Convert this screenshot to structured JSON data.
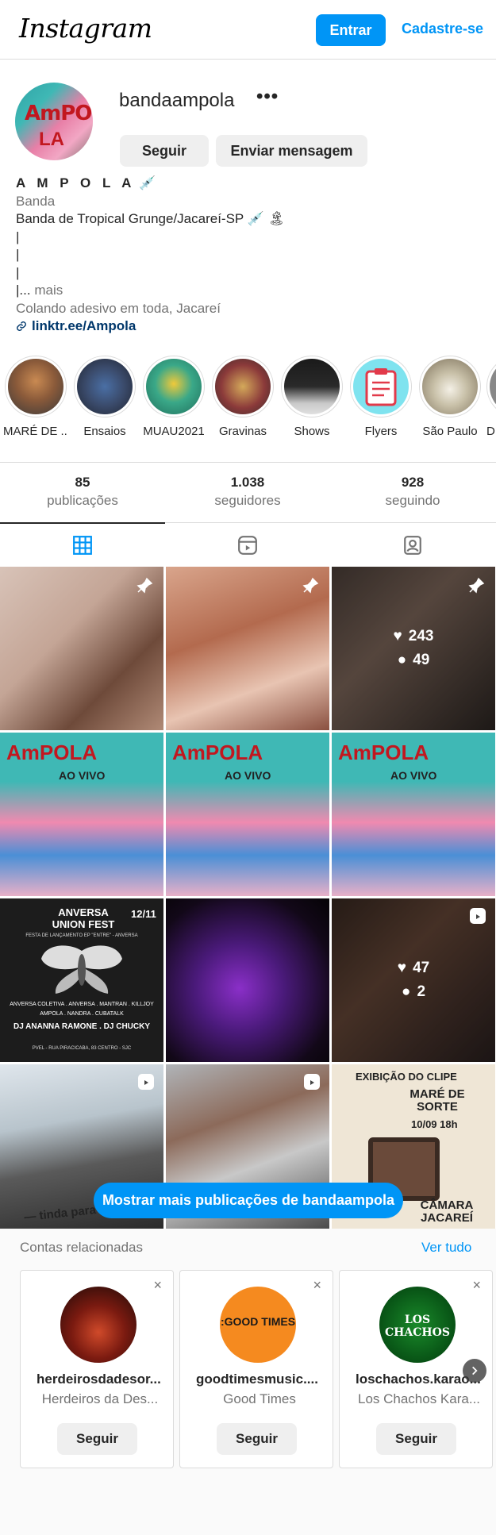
{
  "header": {
    "logo": "Instagram",
    "login_label": "Entrar",
    "signup_label": "Cadastre-se"
  },
  "profile": {
    "username": "bandaampola",
    "more_label": "•••",
    "follow_label": "Seguir",
    "message_label": "Enviar mensagem",
    "avatar_text_top": "AmPOLA",
    "avatar_text_bottom": "LA"
  },
  "bio": {
    "name": "A M P O L A",
    "name_emoji": "💉",
    "category": "Banda",
    "description": "Banda de Tropical Grunge/Jacareí-SP 💉 🏝",
    "lines": [
      "|",
      "|",
      "|"
    ],
    "more_prefix": "|...",
    "more_label": "mais",
    "tagline": "Colando adesivo em toda, Jacareí",
    "link": "linktr.ee/Ampola"
  },
  "highlights": [
    {
      "label": "MARÉ DE ..."
    },
    {
      "label": "Ensaios"
    },
    {
      "label": "MUAU2021"
    },
    {
      "label": "Gravinas"
    },
    {
      "label": "Shows"
    },
    {
      "label": "Flyers"
    },
    {
      "label": "São Paulo"
    },
    {
      "label": "D"
    }
  ],
  "stats": [
    {
      "num": "85",
      "label": "publicações"
    },
    {
      "num": "1.038",
      "label": "seguidores"
    },
    {
      "num": "928",
      "label": "seguindo"
    }
  ],
  "posts": {
    "tile3_likes": "243",
    "tile3_comments": "49",
    "tile9_likes": "47",
    "tile9_comments": "2",
    "poster_ampola": "AmPOLA",
    "poster_aovivo": "AO VIVO",
    "poster_anversa_title": "ANVERSA UNION FEST",
    "poster_anversa_date": "12/11",
    "poster_anversa_sub": "FESTA DE LANÇAMENTO EP \"ENTRE\" - ANVERSA",
    "poster_anversa_bands": "ANVERSA COLETIVA . ANVERSA . MANTRAN . KILLJOY",
    "poster_anversa_bands2": "AMPOLA . NANDRA . CUBATALK",
    "poster_anversa_djs": "DJ ANANNA RAMONE . DJ CHUCKY",
    "poster_anversa_addr": "PVEL - RUA PIRACICABA, 83 CENTRO - SJC",
    "poster_clip_title": "EXIBIÇÃO DO CLIPE",
    "poster_clip_name": "MARÉ DE SORTE",
    "poster_clip_date": "10/09 18h",
    "poster_clip_place": "CÂMARA JACAREÍ",
    "video_caption": "— tinda para gravação"
  },
  "show_more_label": "Mostrar mais publicações de bandaampola",
  "related": {
    "title": "Contas relacionadas",
    "see_all": "Ver tudo",
    "cards": [
      {
        "user": "herdeirosdadesor...",
        "name": "Herdeiros da Des...",
        "btn": "Seguir",
        "close": "×",
        "logo": ""
      },
      {
        "user": "goodtimesmusic....",
        "name": "Good Times",
        "btn": "Seguir",
        "close": "×",
        "logo": ":GOOD TIMES"
      },
      {
        "user": "loschachos.karao...",
        "name": "Los Chachos Kara...",
        "btn": "Seguir",
        "close": "×",
        "logo": "LOS CHACHOS"
      }
    ]
  },
  "colors": {
    "accent": "#0095f6",
    "link": "#00376b",
    "muted": "#737373",
    "border": "#dbdbdb"
  }
}
